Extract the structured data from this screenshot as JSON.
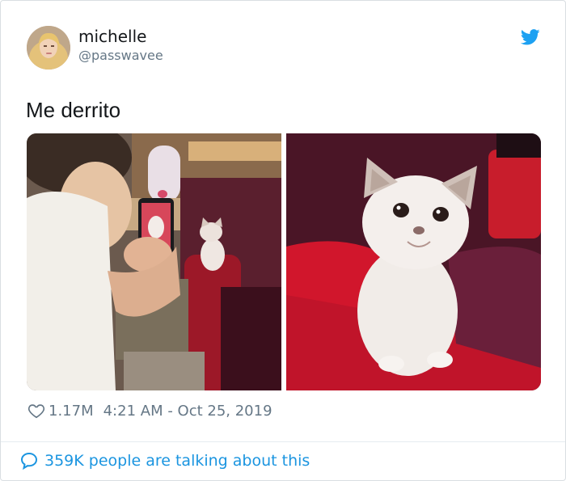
{
  "user": {
    "name": "michelle",
    "handle": "@passwavee"
  },
  "tweet": {
    "text": "Me derrito"
  },
  "photos": [
    {
      "subject": "person photographing kitten on red armchair"
    },
    {
      "subject": "close-up fluffy white kitten on red cushion"
    }
  ],
  "meta": {
    "likes": "1.17M",
    "timestamp": "4:21 AM - Oct 25, 2019"
  },
  "footer": {
    "talking": "359K people are talking about this"
  },
  "icons": {
    "brand": "twitter-bird-icon",
    "like": "heart-icon",
    "reply": "speech-bubble-icon"
  },
  "colors": {
    "accent": "#1b95e0",
    "secondary": "#657786",
    "text": "#14171a"
  }
}
